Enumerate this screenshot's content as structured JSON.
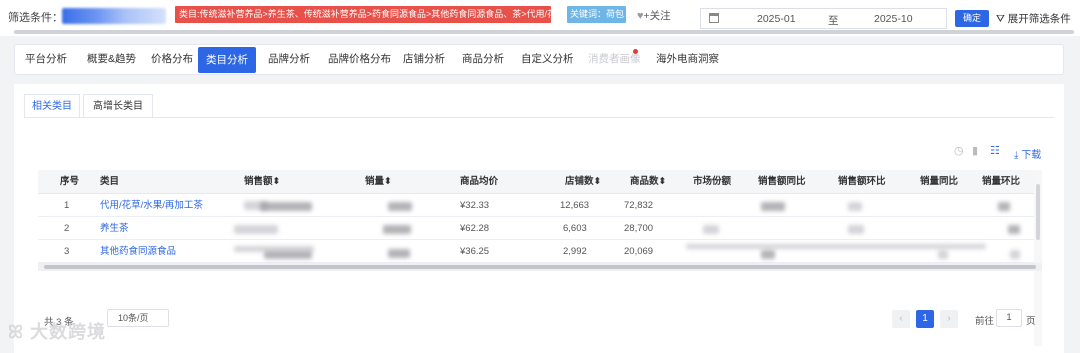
{
  "filter": {
    "label": "筛选条件：",
    "category_tag": "类目:传统滋补营养品>养生茶、传统滋补营养品>药食同源食品>其他药食同源食品、茶>代用/花草/水果/再加工茶",
    "keyword_tag": "关键词：荷包",
    "follow": "+关注",
    "date_from": "2025-01",
    "date_sep": "至",
    "date_to": "2025-10",
    "confirm_button": "确定",
    "expand_button": "展开筛选条件"
  },
  "nav": {
    "tabs": [
      {
        "label": "平台分析"
      },
      {
        "label": "概要&趋势"
      },
      {
        "label": "价格分布"
      },
      {
        "label": "类目分析"
      },
      {
        "label": "品牌分析"
      },
      {
        "label": "品牌价格分布"
      },
      {
        "label": "店铺分析"
      },
      {
        "label": "商品分析"
      },
      {
        "label": "自定义分析"
      },
      {
        "label": "消费者画像"
      },
      {
        "label": "海外电商洞察"
      }
    ],
    "active_index": 3
  },
  "subtabs": [
    {
      "label": "相关类目"
    },
    {
      "label": "高增长类目"
    }
  ],
  "toolbar": {
    "download": "下载"
  },
  "table": {
    "columns": [
      "序号",
      "类目",
      "销售额",
      "销量",
      "商品均价",
      "店铺数",
      "商品数",
      "市场份额",
      "销售额同比",
      "销售额环比",
      "销量同比",
      "销量环比"
    ],
    "rows": [
      {
        "index": "1",
        "category": "代用/花草/水果/再加工茶",
        "avg_price": "¥32.33",
        "shops": "12,663",
        "items": "72,832"
      },
      {
        "index": "2",
        "category": "养生茶",
        "avg_price": "¥62.28",
        "shops": "6,603",
        "items": "28,700"
      },
      {
        "index": "3",
        "category": "其他药食同源食品",
        "avg_price": "¥36.25",
        "shops": "2,992",
        "items": "20,069"
      }
    ]
  },
  "pagination": {
    "total": "共 3 条",
    "page_size": "10条/页",
    "current": "1",
    "goto_label": "前往",
    "goto_value": "1",
    "page_suffix": "页"
  },
  "watermark": "大数跨境",
  "colors": {
    "accent": "#2e67e6",
    "tag_red": "#e8504a",
    "tag_keyword": "#6fb6e6"
  }
}
